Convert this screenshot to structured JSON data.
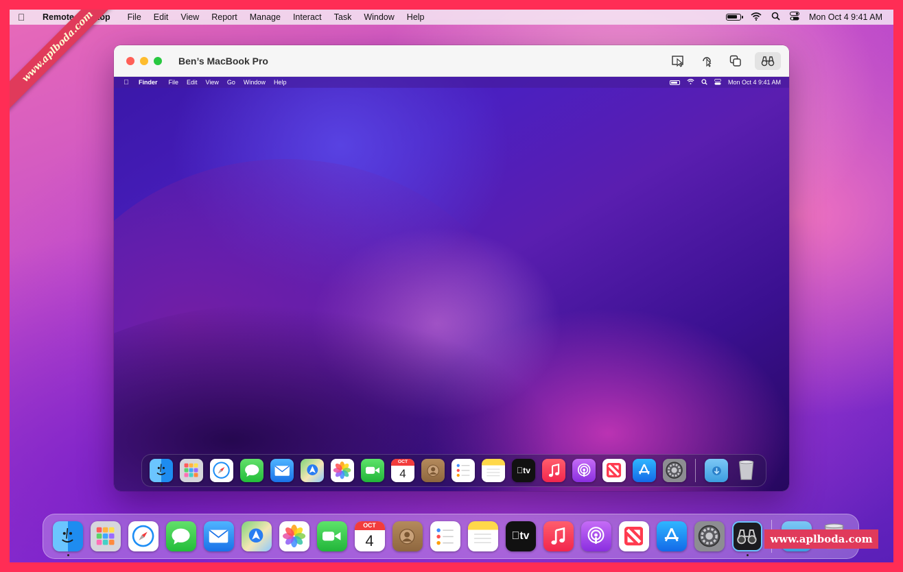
{
  "menubar": {
    "app_name": "Remote Desktop",
    "items": [
      "File",
      "Edit",
      "View",
      "Report",
      "Manage",
      "Interact",
      "Task",
      "Window",
      "Help"
    ],
    "datetime": "Mon Oct 4  9:41 AM"
  },
  "window": {
    "title": "Ben’s MacBook Pro",
    "tools": [
      "observe-icon",
      "curtain-icon",
      "copy-icon",
      "binoculars-icon"
    ]
  },
  "remote": {
    "menubar": {
      "app_name": "Finder",
      "items": [
        "File",
        "Edit",
        "View",
        "Go",
        "Window",
        "Help"
      ],
      "datetime": "Mon Oct 4  9:41 AM"
    }
  },
  "calendar": {
    "month": "OCT",
    "day": "4"
  },
  "dock_apps": [
    "Finder",
    "Launchpad",
    "Safari",
    "Messages",
    "Mail",
    "Maps",
    "Photos",
    "FaceTime",
    "Calendar",
    "Contacts",
    "Reminders",
    "Notes",
    "TV",
    "Music",
    "Podcasts",
    "News",
    "App Store",
    "System Preferences"
  ],
  "tv_label": "tv",
  "watermarks": {
    "ribbon": "www.aplboda.com",
    "box": "www.aplboda.com"
  },
  "colors": {
    "frame": "#ff2d55",
    "watermark_bg": "#e03a5b"
  }
}
